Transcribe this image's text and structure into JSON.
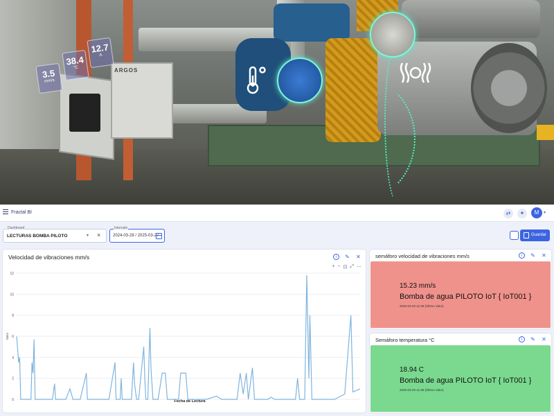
{
  "photo": {
    "panel_logo": "ARGOS",
    "sensors": [
      {
        "value": "3.5",
        "unit": "mm/s"
      },
      {
        "value": "38.4",
        "unit": "°C"
      },
      {
        "value": "12.7",
        "unit": "A"
      }
    ],
    "icons": [
      "thermometer-icon",
      "vibration-icon"
    ]
  },
  "topbar": {
    "app_title": "Fractal BI",
    "avatar_initial": "M"
  },
  "filters": {
    "dashboard_legend": "Dashboard",
    "dashboard_value": "LECTURAS BOMBA PILOTO",
    "date_legend": "Intervalo",
    "date_value": "2024-03-28 / 2025-03-27"
  },
  "toolbar": {
    "save_label": "Guardar"
  },
  "chart_card": {
    "title": "Velocidad de vibraciones mm/s"
  },
  "chart_data": {
    "type": "line",
    "title": "Velocidad de vibraciones mm/s",
    "xlabel": "Fecha de Lectura",
    "ylabel": "Valor",
    "ylim": [
      0,
      12
    ],
    "yticks": [
      0,
      2,
      4,
      6,
      8,
      10,
      12
    ],
    "grid": true,
    "color": "#7fb4de",
    "series": [
      {
        "values": [
          [
            0,
            6
          ],
          [
            2,
            3.5
          ],
          [
            3,
            4
          ],
          [
            4,
            0
          ],
          [
            14,
            0
          ],
          [
            15,
            3.5
          ],
          [
            16,
            2.5
          ],
          [
            17,
            5.7
          ],
          [
            18,
            0
          ],
          [
            35,
            0
          ],
          [
            37,
            1.5
          ],
          [
            38,
            0
          ],
          [
            48,
            0
          ],
          [
            52,
            1
          ],
          [
            55,
            0
          ],
          [
            62,
            0
          ],
          [
            68,
            2.5
          ],
          [
            69,
            0
          ],
          [
            90,
            0
          ],
          [
            96,
            3.5
          ],
          [
            97,
            0
          ],
          [
            101,
            0
          ],
          [
            102,
            2
          ],
          [
            103,
            0
          ],
          [
            112,
            0
          ],
          [
            114,
            3.5
          ],
          [
            115,
            1.5
          ],
          [
            117,
            0
          ],
          [
            119,
            0
          ],
          [
            124,
            5
          ],
          [
            125,
            2
          ],
          [
            126,
            0
          ],
          [
            128,
            0
          ],
          [
            130,
            6.8
          ],
          [
            131,
            3
          ],
          [
            133,
            0
          ],
          [
            138,
            0
          ],
          [
            142,
            2.5
          ],
          [
            145,
            2.5
          ],
          [
            147,
            0
          ],
          [
            158,
            0
          ],
          [
            160,
            2.5
          ],
          [
            165,
            2.5
          ],
          [
            167,
            0
          ],
          [
            185,
            0
          ],
          [
            195,
            0.3
          ],
          [
            200,
            0
          ],
          [
            215,
            0
          ],
          [
            218,
            2.5
          ],
          [
            221,
            0.5
          ],
          [
            224,
            2.5
          ],
          [
            226,
            0
          ],
          [
            230,
            3
          ],
          [
            232,
            0
          ],
          [
            245,
            0
          ],
          [
            248,
            0.2
          ],
          [
            252,
            0
          ],
          [
            272,
            0
          ],
          [
            274,
            2
          ],
          [
            276,
            0
          ],
          [
            281,
            0
          ],
          [
            283,
            11.8
          ],
          [
            285,
            2
          ],
          [
            286,
            8
          ],
          [
            288,
            0
          ],
          [
            310,
            0
          ],
          [
            320,
            0.5
          ],
          [
            326,
            8
          ],
          [
            328,
            0.7
          ],
          [
            335,
            1
          ]
        ]
      }
    ]
  },
  "semaforo_vib": {
    "title": "semáforo velocidad de vibraciones mm/s",
    "value": "15.23 mm/s",
    "device": "Bomba de agua PILOTO IoT { IoT001 }",
    "timestamp": "2025-03-20 11:09 (Último Valor)",
    "color": "#f0928c"
  },
  "semaforo_temp": {
    "title": "Semáforo temperatura °C",
    "value": "18.94 C",
    "device": "Bomba de agua PILOTO IoT { IoT001 }",
    "timestamp": "2025-03-20 11:09 (Último Valor)",
    "color": "#7ad98f"
  }
}
